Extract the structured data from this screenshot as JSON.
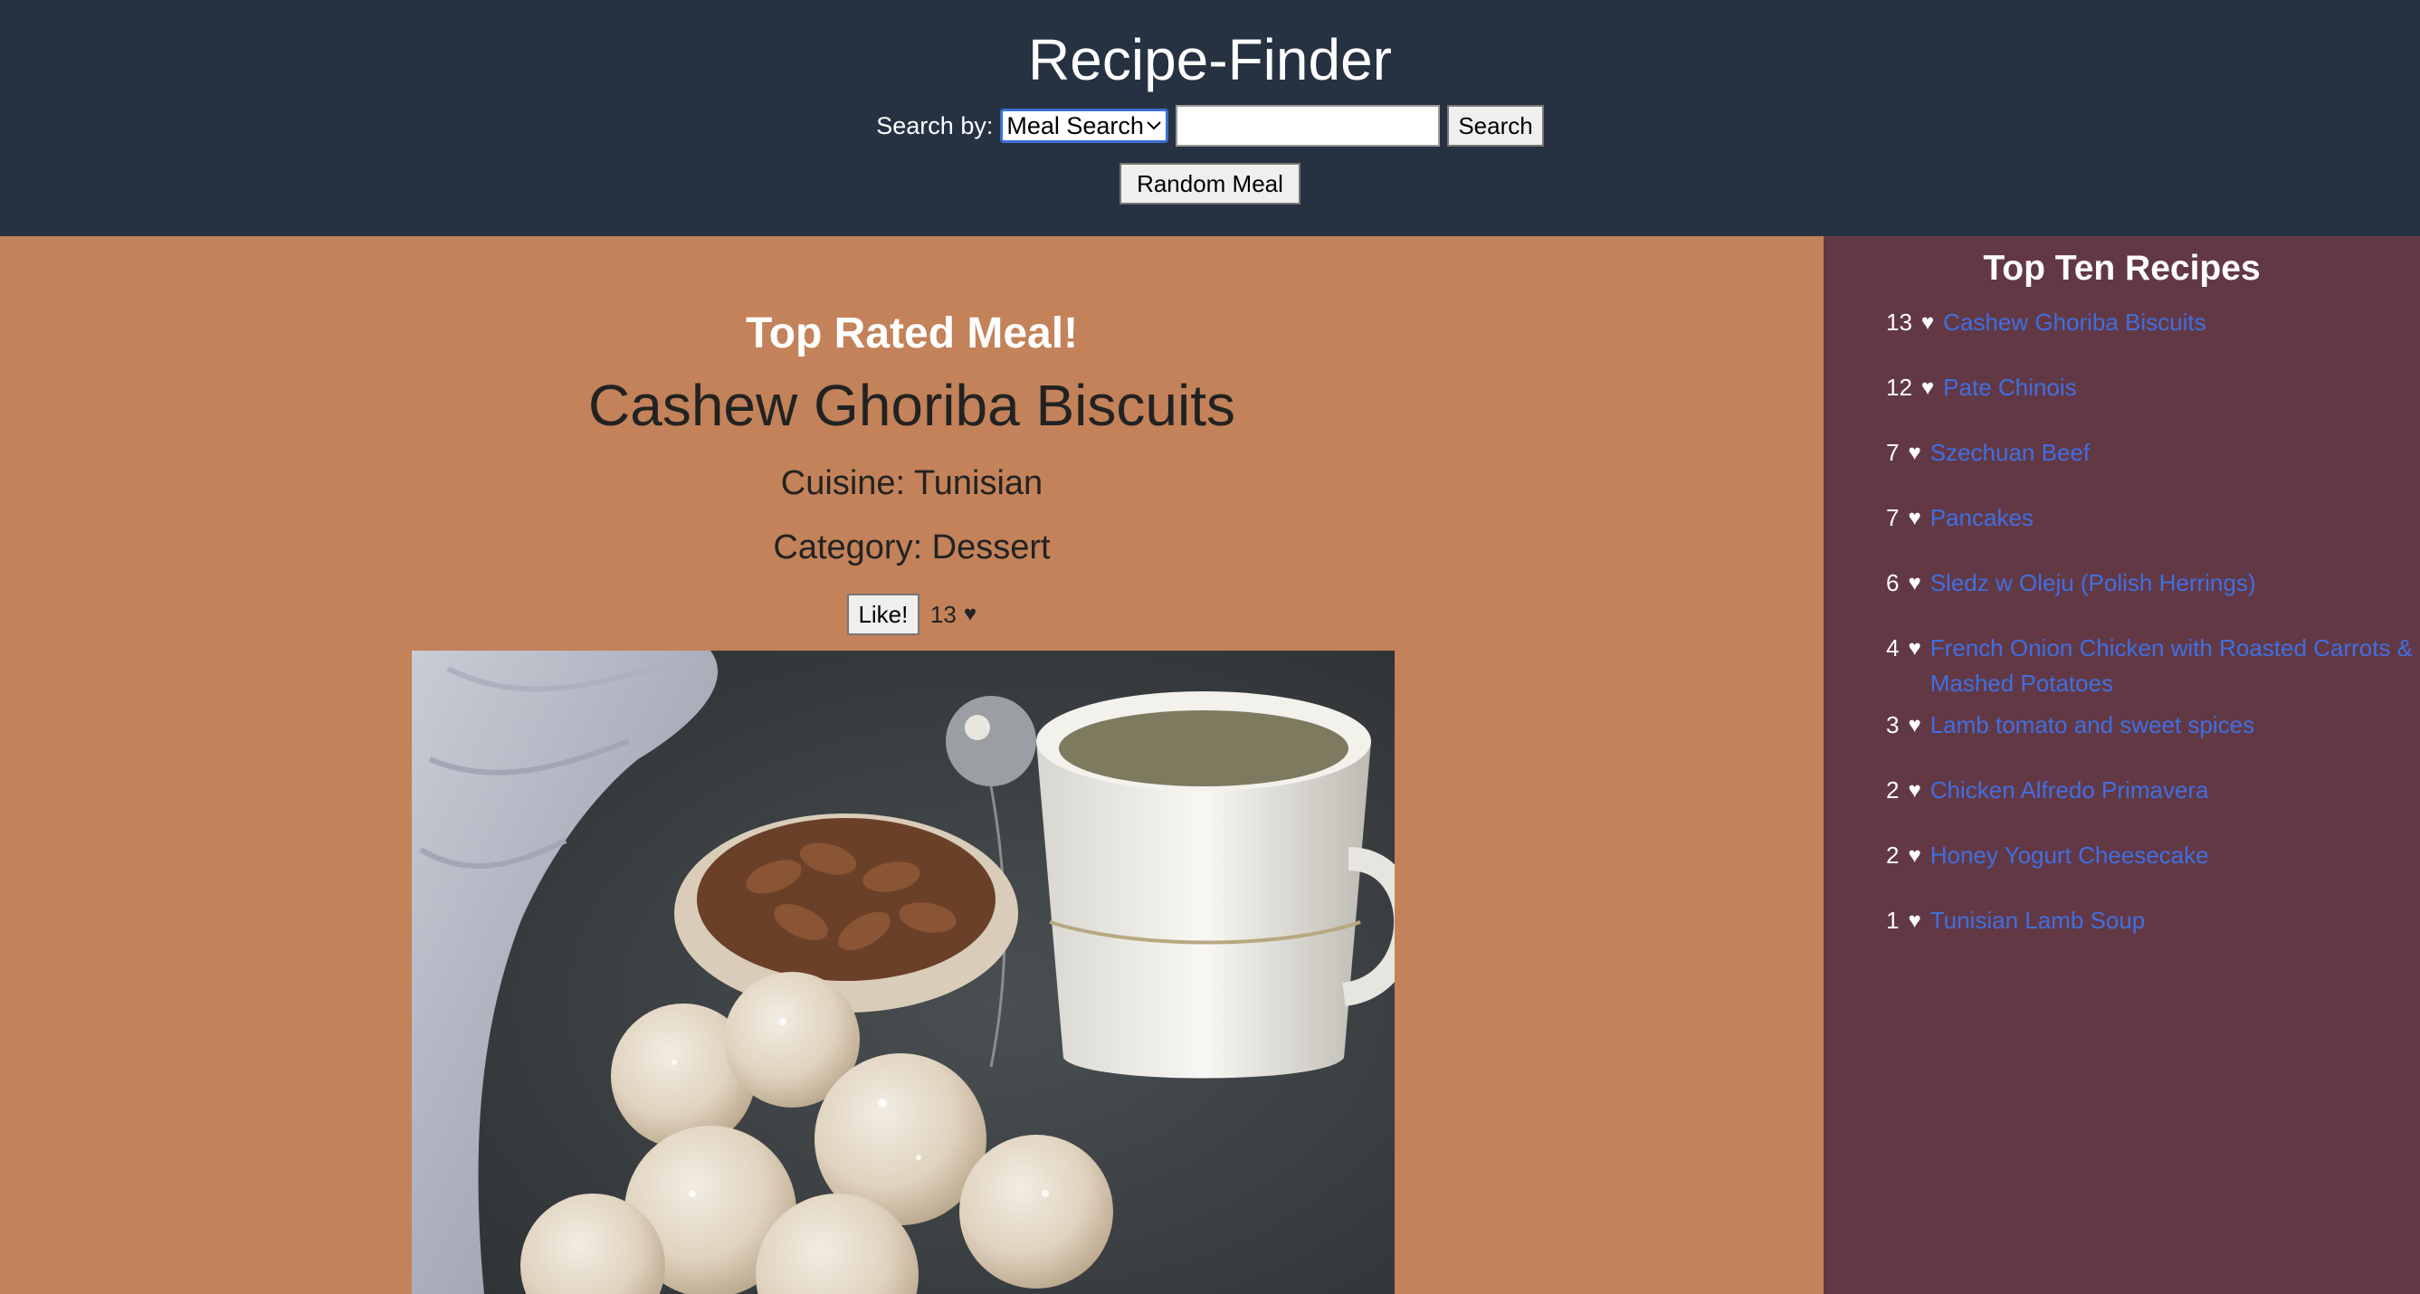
{
  "header": {
    "title": "Recipe-Finder",
    "search_label": "Search by:",
    "search_type_selected": "Meal Search",
    "search_value": "",
    "search_button": "Search",
    "random_button": "Random Meal"
  },
  "main": {
    "top_rated_heading": "Top Rated Meal!",
    "meal_name": "Cashew Ghoriba Biscuits",
    "cuisine": "Cuisine: Tunisian",
    "category": "Category: Dessert",
    "like_button": "Like!",
    "like_count": "13",
    "heart_icon": "♥"
  },
  "sidebar": {
    "title": "Top Ten Recipes",
    "heart_icon": "♥",
    "items": [
      {
        "count": "13",
        "name": "Cashew Ghoriba Biscuits"
      },
      {
        "count": "12",
        "name": "Pate Chinois"
      },
      {
        "count": "7",
        "name": "Szechuan Beef"
      },
      {
        "count": "7",
        "name": "Pancakes"
      },
      {
        "count": "6",
        "name": "Sledz w Oleju (Polish Herrings)"
      },
      {
        "count": "4",
        "name": "French Onion Chicken with Roasted Carrots & Mashed Potatoes"
      },
      {
        "count": "3",
        "name": "Lamb tomato and sweet spices"
      },
      {
        "count": "2",
        "name": "Chicken Alfredo Primavera"
      },
      {
        "count": "2",
        "name": "Honey Yogurt Cheesecake"
      },
      {
        "count": "1",
        "name": "Tunisian Lamb Soup"
      }
    ]
  },
  "colors": {
    "header_bg": "#263241",
    "main_bg": "#c38259",
    "sidebar_bg": "#633845",
    "link": "#3f6fe0"
  }
}
